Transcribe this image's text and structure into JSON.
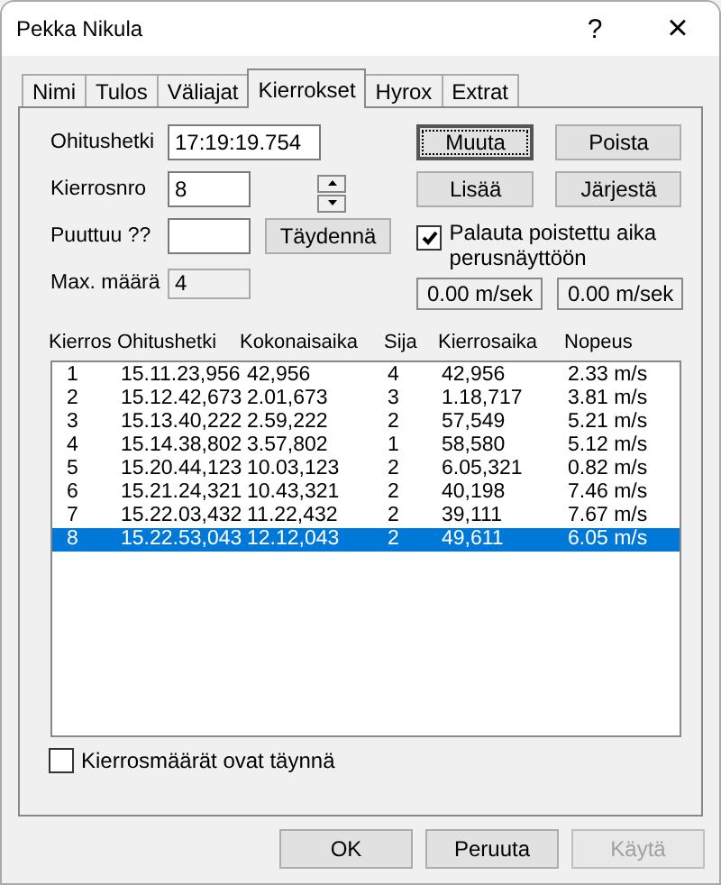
{
  "window": {
    "title": "Pekka Nikula",
    "help": "?",
    "close": "×"
  },
  "tabs": [
    {
      "label": "Nimi",
      "selected": false
    },
    {
      "label": "Tulos",
      "selected": false
    },
    {
      "label": "Väliajat",
      "selected": false
    },
    {
      "label": "Kierrokset",
      "selected": true
    },
    {
      "label": "Hyrox",
      "selected": false
    },
    {
      "label": "Extrat",
      "selected": false
    }
  ],
  "form": {
    "ohitushetki": {
      "label": "Ohitushetki",
      "value": "17:19:19.754"
    },
    "kierrosnro": {
      "label": "Kierrosnro",
      "value": "8"
    },
    "puuttuu": {
      "label": "Puuttuu ??"
    },
    "max_maara": {
      "label": "Max. määrä",
      "value": "4"
    },
    "taydenna_button": "Täydennä",
    "buttons": [
      {
        "label": "Muuta",
        "focused": true
      },
      {
        "label": "Poista",
        "focused": false
      },
      {
        "label": "Lisää",
        "focused": false
      },
      {
        "label": "Järjestä",
        "focused": false
      }
    ],
    "restore_checkbox": {
      "label": "Palauta poistettu aika perusnäyttöön",
      "checked": true
    },
    "speeds": [
      "0.00 m/sek",
      "0.00 m/sek"
    ]
  },
  "table": {
    "columns": [
      "Kierros",
      "Ohitushetki",
      "Kokonaisaika",
      "Sija",
      "Kierrosaika",
      "Nopeus"
    ],
    "rows": [
      {
        "cells": [
          "1",
          "15.11.23,956",
          "42,956",
          "4",
          "42,956",
          "2.33 m/s"
        ],
        "selected": false
      },
      {
        "cells": [
          "2",
          "15.12.42,673",
          "2.01,673",
          "3",
          "1.18,717",
          "3.81 m/s"
        ],
        "selected": false
      },
      {
        "cells": [
          "3",
          "15.13.40,222",
          "2.59,222",
          "2",
          "57,549",
          "5.21 m/s"
        ],
        "selected": false
      },
      {
        "cells": [
          "4",
          "15.14.38,802",
          "3.57,802",
          "1",
          "58,580",
          "5.12 m/s"
        ],
        "selected": false
      },
      {
        "cells": [
          "5",
          "15.20.44,123",
          "10.03,123",
          "2",
          "6.05,321",
          "0.82 m/s"
        ],
        "selected": false
      },
      {
        "cells": [
          "6",
          "15.21.24,321",
          "10.43,321",
          "2",
          "40,198",
          "7.46 m/s"
        ],
        "selected": false
      },
      {
        "cells": [
          "7",
          "15.22.03,432",
          "11.22,432",
          "2",
          "39,111",
          "7.67 m/s"
        ],
        "selected": false
      },
      {
        "cells": [
          "8",
          "15.22.53,043",
          "12.12,043",
          "2",
          "49,611",
          "6.05 m/s"
        ],
        "selected": true
      }
    ]
  },
  "full_checkbox": {
    "label": "Kierrosmäärät ovat täynnä",
    "checked": false
  },
  "footer_buttons": [
    {
      "label": "OK",
      "disabled": false
    },
    {
      "label": "Peruuta",
      "disabled": false
    },
    {
      "label": "Käytä",
      "disabled": true
    }
  ]
}
